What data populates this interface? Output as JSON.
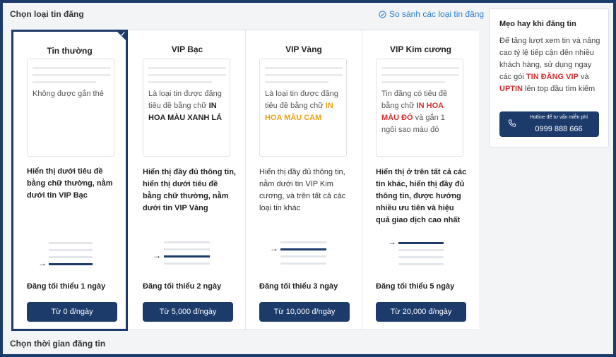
{
  "section_title": "Chọn loại tin đăng",
  "compare_link": "So sánh các loại tin đăng",
  "cards": [
    {
      "name": "Tin thường",
      "preview": "Không được gắn thẻ",
      "description": "Hiển thị dưới tiêu đề bằng chữ thường, nằm dưới tin VIP Bạc",
      "min_days": "Đăng tối thiểu 1 ngày",
      "price": "Từ 0 đ/ngày",
      "selected": true
    },
    {
      "name": "VIP Bạc",
      "preview_prefix": "Là loại tin được đăng tiêu đề bằng chữ ",
      "preview_highlight": "IN HOA MÀU XANH LÁ",
      "preview_suffix": "",
      "description_prefix": "Hiển thị đầy đủ thông tin, hiển thị dưới tiêu đề bằng chữ thường, nằm dưới tin VIP Vàng",
      "min_days": "Đăng tối thiểu 2 ngày",
      "price": "Từ 5,000 đ/ngày"
    },
    {
      "name": "VIP Vàng",
      "preview_prefix": "Là loại tin được đăng tiêu đề bằng chữ ",
      "preview_highlight": "IN HOA MÀU CAM",
      "preview_suffix": "",
      "description": "Hiển thị đầy đủ thông tin, nằm dưới tin VIP Kim cương, và trên tất cả các loại tin khác",
      "min_days": "Đăng tối thiểu 3 ngày",
      "price": "Từ 10,000 đ/ngày"
    },
    {
      "name": "VIP Kim cương",
      "preview_prefix": "Tin đăng có tiêu đề bằng chữ ",
      "preview_highlight": "IN HOA MÀU ĐỎ",
      "preview_suffix": " và gắn 1 ngôi sao màu đỏ",
      "description": "Hiển thị ở trên tất cả các tin khác, hiển thị đầy đủ thông tin, được hướng nhiều ưu tiên và hiệu quả giao dịch cao nhất",
      "min_days": "Đăng tối thiểu 5 ngày",
      "price": "Từ 20,000 đ/ngày"
    }
  ],
  "tips": {
    "title": "Mẹo hay khi đăng tin",
    "body_1": "Để tăng lượt xem tin và nâng cao tỷ lệ tiếp cận đến nhiều khách hàng, sử dụng ngay các gói ",
    "highlight_1": "TIN ĐĂNG VIP",
    "body_2": " và ",
    "highlight_2": "UPTIN",
    "body_3": " lên top đầu tìm kiếm",
    "hotline_label": "Hotline để tư vấn miễn phí",
    "hotline_number": "0999 888 666"
  },
  "section_title_2": "Chọn thời gian đăng tin",
  "colors": {
    "primary": "#1c3b6b",
    "link": "#2a7fd0",
    "orange": "#e8a317",
    "red": "#d32f2f"
  }
}
